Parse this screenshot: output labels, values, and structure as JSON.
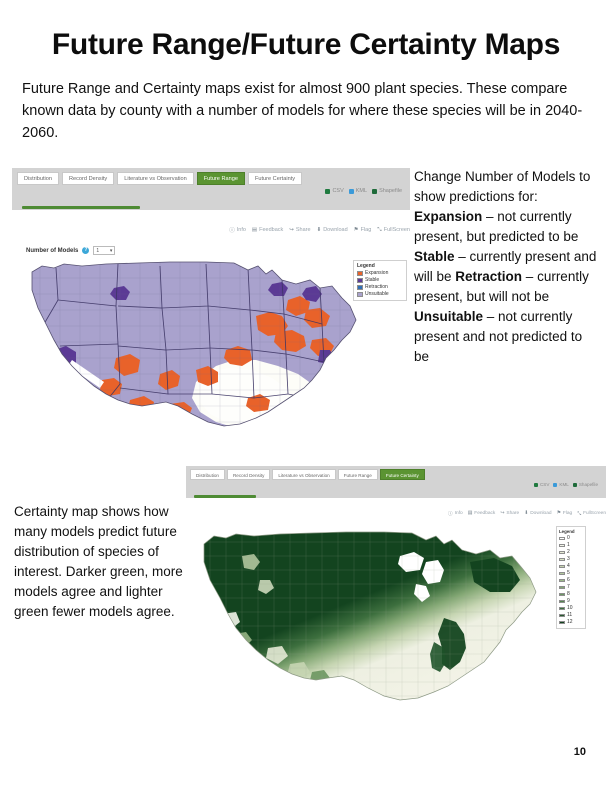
{
  "slide": {
    "title": "Future Range/Future Certainty Maps",
    "intro": "Future Range and Certainty maps exist for almost 900 plant species.  These compare known data by county with a number of models for where these species will be in 2040-2060.",
    "page_number": "10"
  },
  "future_range_shot": {
    "tabs": [
      {
        "label": "Distribution",
        "active": false
      },
      {
        "label": "Record Density",
        "active": false
      },
      {
        "label": "Literature vs Observation",
        "active": false
      },
      {
        "label": "Future Range",
        "active": true
      },
      {
        "label": "Future Certainty",
        "active": false
      }
    ],
    "exports": [
      {
        "label": "CSV",
        "color": "#1f7a3f"
      },
      {
        "label": "KML",
        "color": "#3a9ad9"
      },
      {
        "label": "Shapefile",
        "color": "#1f6b3a"
      }
    ],
    "actions": [
      {
        "label": "Info",
        "icon": "info-icon",
        "glyph": "ⓘ"
      },
      {
        "label": "Feedback",
        "icon": "feedback-icon",
        "glyph": "▤"
      },
      {
        "label": "Share",
        "icon": "share-icon",
        "glyph": "↪"
      },
      {
        "label": "Download",
        "icon": "download-icon",
        "glyph": "⬇"
      },
      {
        "label": "Flag",
        "icon": "flag-icon",
        "glyph": "⚑"
      },
      {
        "label": "FullScreen",
        "icon": "fullscreen-icon",
        "glyph": "⤡"
      }
    ],
    "number_of_models": {
      "label": "Number of Models",
      "help_glyph": "?",
      "value": "1",
      "caret": "▾"
    },
    "legend": {
      "title": "Legend",
      "items": [
        {
          "label": "Expansion",
          "color": "#e8622a"
        },
        {
          "label": "Stable",
          "color": "#5b3a95"
        },
        {
          "label": "Retraction",
          "color": "#2f6fb5"
        },
        {
          "label": "Unsuitable",
          "color": "#a9a2cd"
        }
      ]
    }
  },
  "future_certainty_shot": {
    "tabs": [
      {
        "label": "Distribution",
        "active": false
      },
      {
        "label": "Record Density",
        "active": false
      },
      {
        "label": "Literature vs Observation",
        "active": false
      },
      {
        "label": "Future Range",
        "active": false
      },
      {
        "label": "Future Certainty",
        "active": true
      }
    ],
    "exports": [
      {
        "label": "CSV",
        "color": "#1f7a3f"
      },
      {
        "label": "KML",
        "color": "#3a9ad9"
      },
      {
        "label": "Shapefile",
        "color": "#1f6b3a"
      }
    ],
    "actions": [
      {
        "label": "Info",
        "icon": "info-icon",
        "glyph": "ⓘ"
      },
      {
        "label": "Feedback",
        "icon": "feedback-icon",
        "glyph": "▤"
      },
      {
        "label": "Share",
        "icon": "share-icon",
        "glyph": "↪"
      },
      {
        "label": "Download",
        "icon": "download-icon",
        "glyph": "⬇"
      },
      {
        "label": "Flag",
        "icon": "flag-icon",
        "glyph": "⚑"
      },
      {
        "label": "FullScreen",
        "icon": "fullscreen-icon",
        "glyph": "⤡"
      }
    ],
    "legend": {
      "title": "Legend",
      "items": [
        {
          "label": "0",
          "color": "#ffffff"
        },
        {
          "label": "1",
          "color": "#f3f5ea"
        },
        {
          "label": "2",
          "color": "#e6ead6"
        },
        {
          "label": "3",
          "color": "#d7e0c4"
        },
        {
          "label": "4",
          "color": "#c6d5b2"
        },
        {
          "label": "5",
          "color": "#b2c79e"
        },
        {
          "label": "6",
          "color": "#9cb98a"
        },
        {
          "label": "7",
          "color": "#84a875"
        },
        {
          "label": "8",
          "color": "#6b9661"
        },
        {
          "label": "9",
          "color": "#54834f"
        },
        {
          "label": "10",
          "color": "#3d6f3e"
        },
        {
          "label": "11",
          "color": "#275a2e"
        },
        {
          "label": "12",
          "color": "#13441f"
        }
      ]
    }
  },
  "models_note": {
    "lead": "Change Number of Models to show predictions for:",
    "definitions": [
      {
        "term": "Expansion",
        "dash": " – ",
        "text": "not currently present, but predicted to be"
      },
      {
        "term": "Stable",
        "dash": " – ",
        "text": "currently present and will be"
      },
      {
        "term": "Retraction",
        "dash": " – ",
        "text": "currently present, but will not be"
      },
      {
        "term": "Unsuitable",
        "dash": " – ",
        "text": "not currently present and not predicted to be"
      }
    ]
  },
  "certainty_note": {
    "text": "Certainty map shows how many models predict future distribution of species of interest. Darker green, more models agree and lighter green fewer models agree."
  }
}
